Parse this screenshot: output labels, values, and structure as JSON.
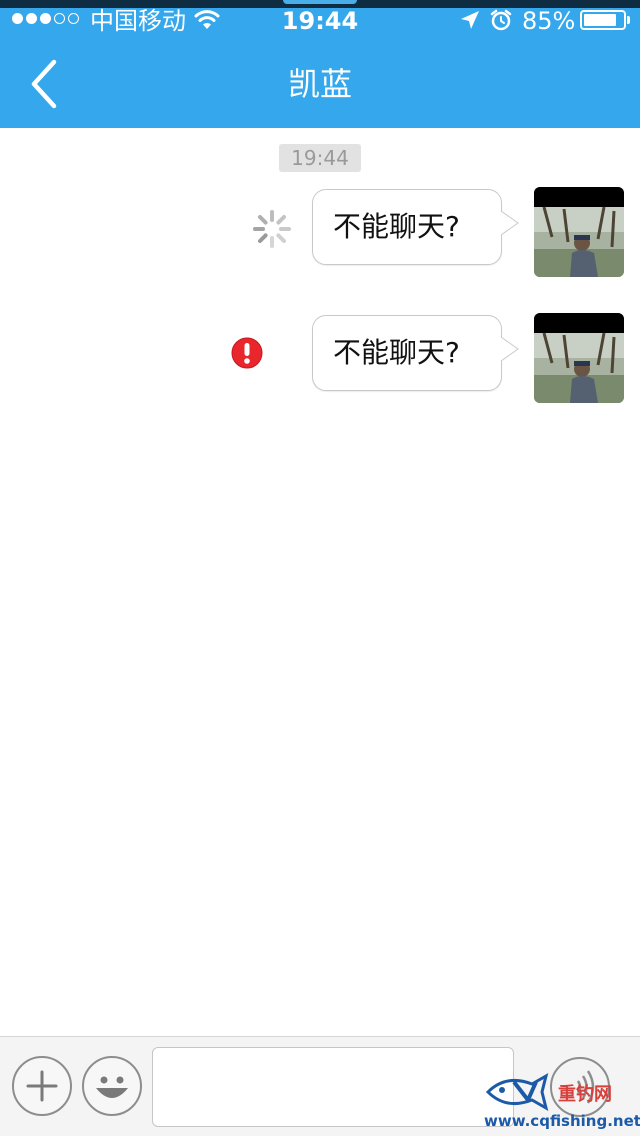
{
  "status_bar": {
    "carrier": "中国移动",
    "time": "19:44",
    "battery_percent": "85%",
    "battery_level": 0.85,
    "signal_bars": 3,
    "signal_total": 5
  },
  "nav": {
    "title": "凯蓝",
    "back_icon": "chevron-left-icon"
  },
  "chat": {
    "timestamp": "19:44",
    "messages": [
      {
        "text": "不能聊天?",
        "status": "sending",
        "status_icon": "loading-spinner-icon"
      },
      {
        "text": "不能聊天?",
        "status": "failed",
        "status_icon": "error-exclamation-icon"
      }
    ]
  },
  "input_bar": {
    "plus_icon": "plus-icon",
    "emoji_icon": "smiley-icon",
    "message_value": "",
    "voice_icon": "voice-icon"
  },
  "watermark": {
    "brand": "重钓网",
    "url": "www.cqfishing.net"
  },
  "colors": {
    "header": "#35a7ec",
    "error": "#e8262b",
    "brand": "#d7403b",
    "url": "#1c5aa8"
  }
}
